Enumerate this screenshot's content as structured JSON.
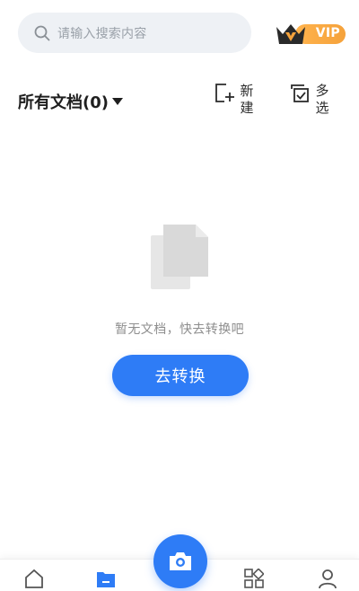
{
  "search": {
    "placeholder": "请输入搜索内容"
  },
  "vip": {
    "label": "VIP"
  },
  "header": {
    "folder_title": "所有文档(0)",
    "new_label": "新\n建",
    "multi_select_label": "多\n选"
  },
  "empty_state": {
    "message": "暂无文档，快去转换吧",
    "button_label": "去转换"
  },
  "bottom_nav": {
    "items": [
      "home-icon",
      "documents-icon",
      "camera-icon",
      "apps-icon",
      "profile-icon"
    ],
    "active": "documents-icon"
  },
  "colors": {
    "accent": "#2e7cf6",
    "vip_gold": "#f5a23b",
    "search_bg": "#eef1f5"
  }
}
